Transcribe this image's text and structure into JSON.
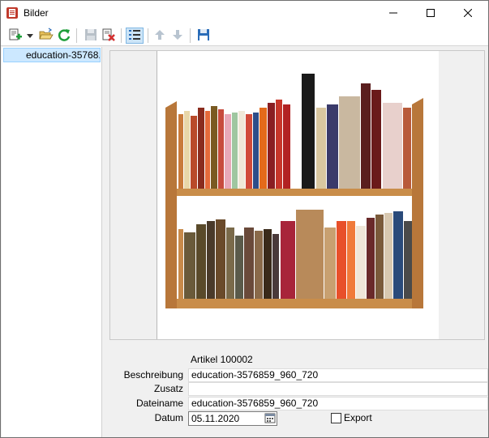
{
  "window": {
    "title": "Bilder",
    "app_icon": "document-list-icon",
    "controls": [
      "minimize-icon",
      "maximize-icon",
      "close-icon"
    ]
  },
  "toolbar": {
    "buttons": [
      {
        "name": "new-icon",
        "has_dropdown": true
      },
      {
        "name": "open-folder-icon"
      },
      {
        "name": "refresh-icon"
      },
      {
        "name": "save-icon",
        "enabled": false
      },
      {
        "name": "delete-icon"
      },
      {
        "name": "list-view-icon",
        "active": true
      },
      {
        "name": "arrow-up-icon",
        "enabled": false
      },
      {
        "name": "arrow-down-icon",
        "enabled": false
      },
      {
        "name": "save-disk-icon"
      }
    ]
  },
  "list": {
    "items": [
      {
        "label": "education-3576859_960_720",
        "display": "education-35768...",
        "selected": true
      }
    ]
  },
  "details": {
    "artikel": "Artikel 100002",
    "beschreibung_label": "Beschreibung",
    "beschreibung_value": "education-3576859_960_720",
    "zusatz_label": "Zusatz",
    "zusatz_value": "",
    "dateiname_label": "Dateiname",
    "dateiname_value": "education-3576859_960_720",
    "datum_label": "Datum",
    "datum_value": "05.11.2020",
    "export_label": "Export",
    "export_checked": false
  },
  "image": {
    "subject": "bookshelf-with-books"
  },
  "colors": {
    "selection_bg": "#cce8ff",
    "selection_border": "#99d1ff",
    "refresh_green": "#1e9e3a",
    "delete_red": "#d32f2f",
    "save_blue": "#2a6cb8"
  }
}
